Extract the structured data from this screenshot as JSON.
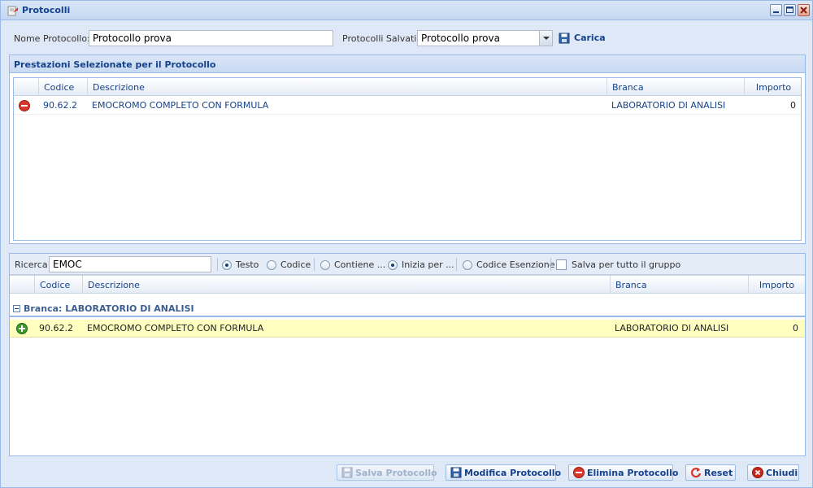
{
  "window": {
    "title": "Protocolli"
  },
  "form": {
    "nome_label": "Nome Protocollo:",
    "nome_value": "Protocollo prova",
    "salvati_label": "Protocolli Salvati:",
    "salvati_value": "Protocollo prova",
    "carica_label": "Carica"
  },
  "selected_panel": {
    "title": "Prestazioni Selezionate per il Protocollo",
    "columns": {
      "codice": "Codice",
      "descrizione": "Descrizione",
      "branca": "Branca",
      "importo": "Importo"
    },
    "rows": [
      {
        "codice": "90.62.2",
        "descrizione": "EMOCROMO COMPLETO CON FORMULA",
        "branca": "LABORATORIO DI ANALISI",
        "importo": "0"
      }
    ]
  },
  "search": {
    "label": "Ricerca",
    "value": "EMOC",
    "options": {
      "testo": "Testo",
      "codice": "Codice",
      "contiene": "Contiene ...",
      "inizia": "Inizia per ...",
      "esenzione": "Codice Esenzione",
      "salva_gruppo": "Salva per tutto il gruppo"
    },
    "selected_type": "Testo",
    "selected_match": "Inizia per ..."
  },
  "results_grid": {
    "columns": {
      "codice": "Codice",
      "descrizione": "Descrizione",
      "branca": "Branca",
      "importo": "Importo"
    },
    "group_label": "Branca: LABORATORIO DI ANALISI",
    "rows": [
      {
        "codice": "90.62.2",
        "descrizione": "EMOCROMO COMPLETO CON FORMULA",
        "branca": "LABORATORIO DI ANALISI",
        "importo": "0"
      }
    ]
  },
  "toolbar": {
    "salva": "Salva Protocollo",
    "modifica": "Modifica Protocollo",
    "elimina": "Elimina Protocollo",
    "reset": "Reset",
    "chiudi": "Chiudi"
  },
  "colors": {
    "header_text": "#15428b",
    "row_highlight": "#ffffc0",
    "window_bg": "#dfe8f6",
    "border": "#99bbe8",
    "remove_red": "#d9362b",
    "add_green": "#3c9a2a"
  },
  "icons": [
    "protocol-icon",
    "minimize-icon",
    "maximize-icon",
    "close-icon",
    "dropdown-arrow-icon",
    "save-icon",
    "remove-icon",
    "add-icon",
    "collapse-icon",
    "reset-icon",
    "close-circle-icon"
  ]
}
